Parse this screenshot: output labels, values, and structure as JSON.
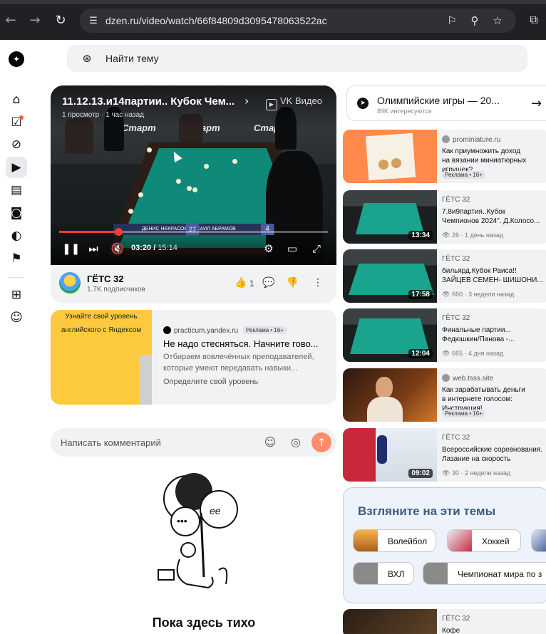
{
  "browser": {
    "url": "dzen.ru/video/watch/66f84809d3095478063522ac"
  },
  "search": {
    "placeholder": "Найти тему"
  },
  "video": {
    "title": "11.12.13.и14партии.. Кубок Чем...",
    "meta": "1 просмотр · 1 час назад",
    "platform": "VK Видео",
    "current_time": "03:20",
    "duration": "15:14",
    "progress_fraction": 0.219,
    "scoreboard_left": "27",
    "scoreboard_right": "4",
    "scoreboard_names": "ДЕНИС НЕКРАСОВ    МИХАИЛ АБРАМОВ",
    "banner": "Старт"
  },
  "channel": {
    "name": "ГЁТС 32",
    "subscribers": "1.7K подписчиков",
    "likes": "1"
  },
  "ad": {
    "image_line1": "Узнайте свой уровень",
    "image_line2": "английского с Яндексом",
    "domain": "practicum.yandex.ru",
    "badge": "Реклама • 16+",
    "title": "Не надо стесняться. Начните гово...",
    "description": "Отбираем вовлечённых преподавателей, которые умеют передавать навыки...",
    "cta": "Определите свой уровень"
  },
  "comments": {
    "placeholder": "Написать комментарий",
    "empty_text": "Пока здесь тихо"
  },
  "topic_card": {
    "name": "Олимпийские игры — 20...",
    "subscribers": "89K интересуются"
  },
  "recommendations": [
    {
      "kind": "ad",
      "channel": "prominiature.ru",
      "title": "Как приумножить доход\nна вязании миниатюрных\nигрушек?",
      "badge": "Реклама • 16+"
    },
    {
      "kind": "video",
      "channel": "ГЁТС 32",
      "title": "7.8и9партия..Кубок\nЧемпионов 2024\". Д.Колосо...",
      "duration": "13:34",
      "meta": "26 · 1 день назад"
    },
    {
      "kind": "video",
      "channel": "ГЁТС 32",
      "title": "бильярд.Кубок Раиса!!\nЗАЙЦЕВ СЕМЕН- ШИШОНИ...",
      "duration": "17:58",
      "meta": "660 · 3 недели назад"
    },
    {
      "kind": "video",
      "channel": "ГЁТС 32",
      "title": "Финальные партии...\nФедюшкин/Панова -...",
      "duration": "12:04",
      "meta": "665 · 4 дня назад"
    },
    {
      "kind": "ad",
      "channel": "web.tsss.site",
      "title": "Как зарабатывать деньги\nв интернете голосом:\nИнструкция!",
      "badge": "Реклама • 16+"
    },
    {
      "kind": "video",
      "channel": "ГЁТС 32",
      "title": "Всероссийские соревнования.\nЛазание на скорость",
      "duration": "09:02",
      "meta": "30 · 2 недели назад"
    },
    {
      "kind": "video",
      "channel": "ГЁТС 32",
      "title": "Кофе",
      "duration": "",
      "meta": ""
    }
  ],
  "themes": {
    "title": "Взгляните на эти темы",
    "chips": [
      "Волейбол",
      "Хоккей",
      "ВХЛ",
      "Чемпионат мира по з"
    ]
  },
  "colors": {
    "accent": "#ff3d2e",
    "send_button": "#ff8c6b",
    "themes_title": "#3c5a7d"
  }
}
